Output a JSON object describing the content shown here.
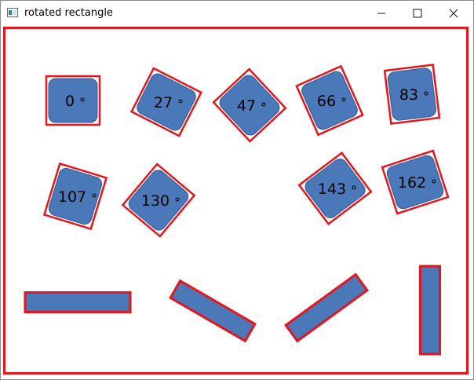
{
  "window": {
    "title": "rotated rectangle",
    "icon": "app-window-icon",
    "controls": [
      "minimize-icon",
      "maximize-icon",
      "close-icon"
    ]
  },
  "colors": {
    "fill": "#4a78b8",
    "outline": "#e8141b",
    "label": "#000000"
  },
  "shapes": {
    "rounded_rotated": [
      {
        "label": "0"
      },
      {
        "label": "27"
      },
      {
        "label": "47"
      },
      {
        "label": "66"
      },
      {
        "label": "83"
      },
      {
        "label": "107"
      },
      {
        "label": "130"
      },
      {
        "label": "143"
      },
      {
        "label": "162"
      }
    ],
    "bars_count": 4
  }
}
